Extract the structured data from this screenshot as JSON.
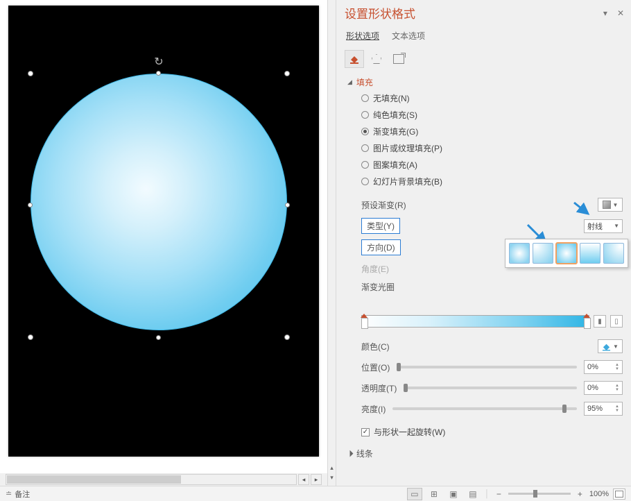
{
  "panel": {
    "title": "设置形状格式",
    "tabs": {
      "shape": "形状选项",
      "text": "文本选项"
    },
    "sections": {
      "fill": "填充",
      "line": "线条"
    },
    "fillOptions": {
      "none": "无填充(N)",
      "solid": "纯色填充(S)",
      "gradient": "渐变填充(G)",
      "picture": "图片或纹理填充(P)",
      "pattern": "图案填充(A)",
      "slidebg": "幻灯片背景填充(B)"
    },
    "labels": {
      "preset": "预设渐变(R)",
      "type": "类型(Y)",
      "direction": "方向(D)",
      "angle": "角度(E)",
      "stops": "渐变光圈",
      "color": "颜色(C)",
      "position": "位置(O)",
      "transparency": "透明度(T)",
      "brightness": "亮度(I)",
      "rotate": "与形状一起旋转(W)"
    },
    "values": {
      "type": "射线",
      "position": "0%",
      "transparency": "0%",
      "brightness": "95%"
    }
  },
  "status": {
    "notes": "备注",
    "zoom": "100%"
  }
}
